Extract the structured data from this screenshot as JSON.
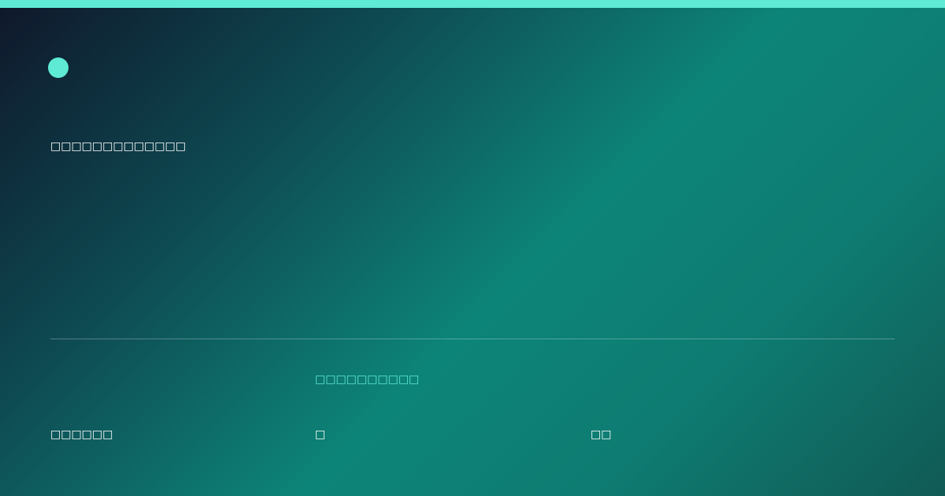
{
  "colors": {
    "accent": "#5eead4",
    "text": "#ffffff",
    "gradient_dark": "#0f172a",
    "gradient_mid": "#0d8478",
    "gradient_end": "#115a55"
  },
  "brand": {
    "icon": "logo-dot-icon"
  },
  "headline": "□□□□□□□□□□□□□",
  "footer": {
    "accent_text": "□□□□□□□□□□",
    "left_text": "□□□□□□",
    "middle_text": "□",
    "right_text": "□□"
  }
}
